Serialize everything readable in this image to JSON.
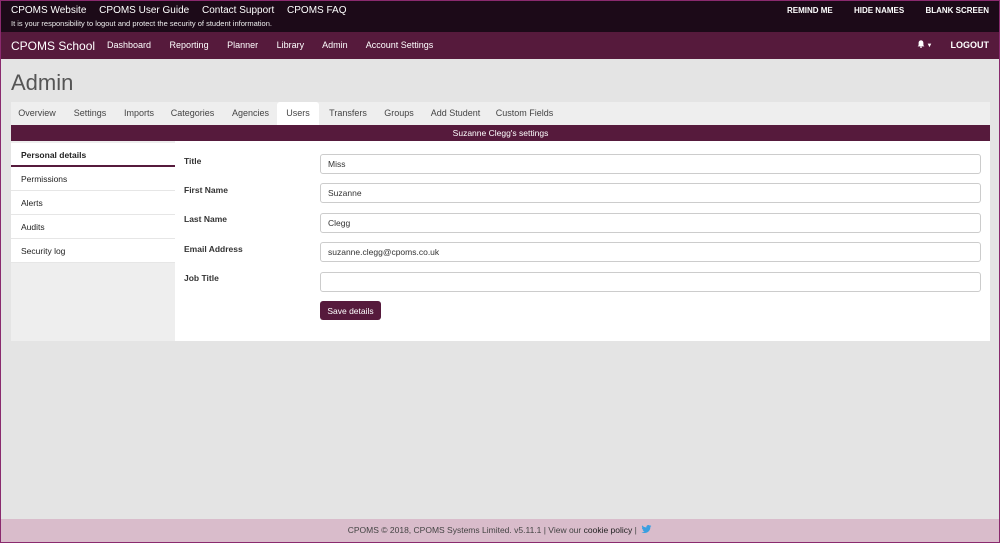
{
  "topbar": {
    "links": [
      "CPOMS Website",
      "CPOMS User Guide",
      "Contact Support",
      "CPOMS FAQ"
    ],
    "warning": "It is your responsibility to logout and protect the security of student information.",
    "actions": [
      "REMIND ME",
      "HIDE NAMES",
      "BLANK SCREEN"
    ]
  },
  "nav": {
    "brand": "CPOMS School",
    "items": [
      "Dashboard",
      "Reporting",
      "Planner",
      "Library",
      "Admin",
      "Account Settings"
    ],
    "logout": "LOGOUT"
  },
  "page": {
    "title": "Admin"
  },
  "tabs": [
    "Overview",
    "Settings",
    "Imports",
    "Categories",
    "Agencies",
    "Users",
    "Transfers",
    "Groups",
    "Add Student",
    "Custom Fields"
  ],
  "active_tab": "Users",
  "section_title": "Suzanne Clegg's settings",
  "sidebar": [
    "Personal details",
    "Permissions",
    "Alerts",
    "Audits",
    "Security log"
  ],
  "form": {
    "fields": [
      {
        "label": "Title",
        "value": "Miss"
      },
      {
        "label": "First Name",
        "value": "Suzanne"
      },
      {
        "label": "Last Name",
        "value": "Clegg"
      },
      {
        "label": "Email Address",
        "value": "suzanne.clegg@cpoms.co.uk"
      },
      {
        "label": "Job Title",
        "value": ""
      }
    ],
    "save_label": "Save details"
  },
  "footer": {
    "text": "CPOMS © 2018, CPOMS Systems Limited. v5.11.1 | View our",
    "cookie": "cookie policy",
    "sep": "|"
  },
  "colors": {
    "primary": "#561a3c",
    "topbar": "#1c0a18",
    "footer": "#d9bccb"
  }
}
